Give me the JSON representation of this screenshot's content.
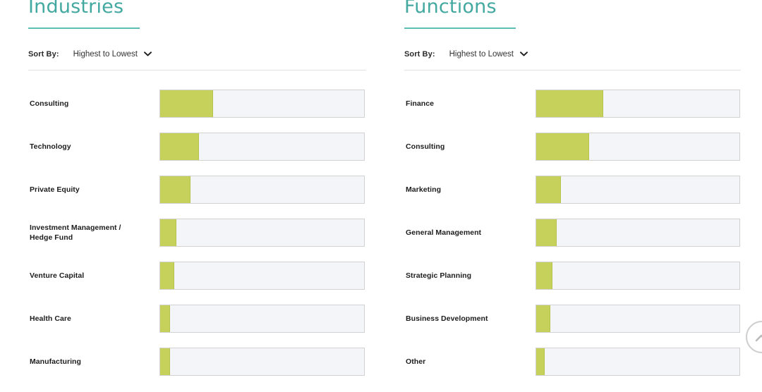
{
  "panels": [
    {
      "title": "Industries",
      "sort": {
        "label": "Sort By:",
        "value": "Highest to Lowest",
        "chevron_icon": "chevron-down-icon",
        "options": [
          "Highest to Lowest"
        ]
      },
      "rows": [
        {
          "label": "Consulting",
          "pct_text": "26%",
          "value": 26
        },
        {
          "label": "Technology",
          "pct_text": "19%",
          "value": 19
        },
        {
          "label": "Private Equity",
          "pct_text": "15%",
          "value": 15
        },
        {
          "label": "Investment Management / Hedge Fund",
          "pct_text": "8%",
          "value": 8
        },
        {
          "label": "Venture Capital",
          "pct_text": "7%",
          "value": 7
        },
        {
          "label": "Health Care",
          "pct_text": "5%",
          "value": 5
        },
        {
          "label": "Manufacturing",
          "pct_text": "5%",
          "value": 5
        }
      ]
    },
    {
      "title": "Functions",
      "sort": {
        "label": "Sort By:",
        "value": "Highest to Lowest",
        "chevron_icon": "chevron-down-icon",
        "options": [
          "Highest to Lowest"
        ]
      },
      "rows": [
        {
          "label": "Finance",
          "pct_text": "33%",
          "value": 33
        },
        {
          "label": "Consulting",
          "pct_text": "26%",
          "value": 26
        },
        {
          "label": "Marketing",
          "pct_text": "12%",
          "value": 12
        },
        {
          "label": "General Management",
          "pct_text": "10%",
          "value": 10
        },
        {
          "label": "Strategic Planning",
          "pct_text": "8%",
          "value": 8
        },
        {
          "label": "Business Development",
          "pct_text": "7%",
          "value": 7
        },
        {
          "label": "Other",
          "pct_text": "4%",
          "value": 4
        }
      ]
    }
  ],
  "scroll_to_top": {
    "icon": "chevron-up-circle-icon"
  },
  "colors": {
    "heading": "#43a9a0",
    "heading_rule": "#5cbdb2",
    "bar_fill": "#c6d15b",
    "bar_track": "#f4f5f9",
    "bar_border": "#d2d2d2",
    "text": "#1d1d1d"
  },
  "chart_data": [
    {
      "type": "bar",
      "title": "Industries",
      "orientation": "horizontal",
      "categories": [
        "Consulting",
        "Technology",
        "Private Equity",
        "Investment Management / Hedge Fund",
        "Venture Capital",
        "Health Care",
        "Manufacturing"
      ],
      "values": [
        26,
        19,
        15,
        8,
        7,
        5,
        5
      ],
      "unit": "%",
      "xlabel": "",
      "ylabel": "",
      "xlim": [
        0,
        100
      ],
      "grid": false,
      "legend": "none",
      "sort": "Highest to Lowest"
    },
    {
      "type": "bar",
      "title": "Functions",
      "orientation": "horizontal",
      "categories": [
        "Finance",
        "Consulting",
        "Marketing",
        "General Management",
        "Strategic Planning",
        "Business Development",
        "Other"
      ],
      "values": [
        33,
        26,
        12,
        10,
        8,
        7,
        4
      ],
      "unit": "%",
      "xlabel": "",
      "ylabel": "",
      "xlim": [
        0,
        100
      ],
      "grid": false,
      "legend": "none",
      "sort": "Highest to Lowest"
    }
  ]
}
